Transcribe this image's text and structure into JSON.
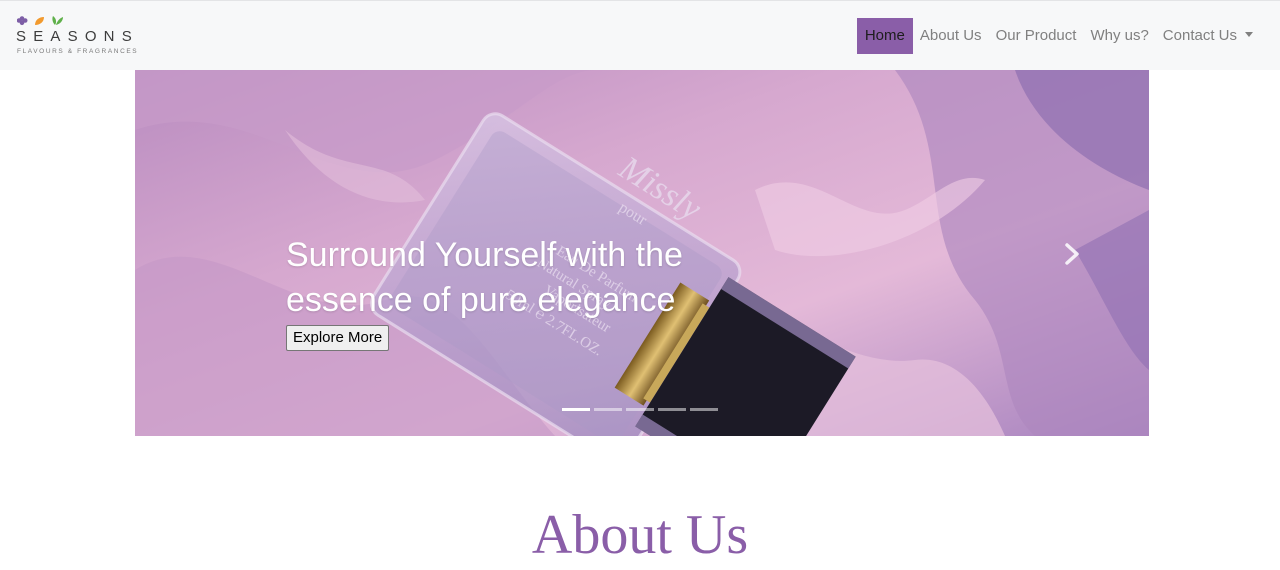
{
  "brand": {
    "name": "SEASONS",
    "tagline": "FLAVOURS & FRAGRANCES",
    "leaf_colors": [
      "#7d5ea6",
      "#f29a2e",
      "#5fb04a"
    ]
  },
  "nav": {
    "items": [
      {
        "label": "Home",
        "active": true
      },
      {
        "label": "About Us",
        "active": false
      },
      {
        "label": "Our Product",
        "active": false
      },
      {
        "label": "Why us?",
        "active": false
      },
      {
        "label": "Contact Us",
        "active": false,
        "dropdown": true
      }
    ],
    "active_color": "#8a5ea8"
  },
  "hero": {
    "title": "Surround Yourself with the essence of pure elegance",
    "button_label": "Explore More",
    "bottle_text": [
      "Missly",
      "pour",
      "Eau De Parfum",
      "Natural Spray",
      "Vaporisateur",
      "50ml ℮ 2.7FL.OZ."
    ],
    "slide_count": 5,
    "active_slide": 1,
    "next_icon": "chevron-right-icon"
  },
  "about": {
    "heading": "About Us",
    "color": "#8a5ea8"
  }
}
